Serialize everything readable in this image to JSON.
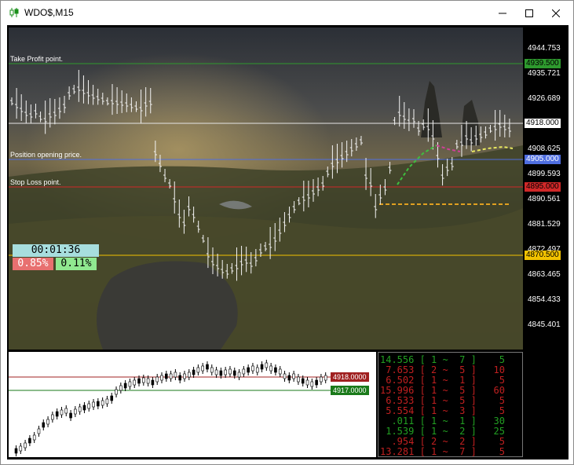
{
  "window": {
    "title": "WDO$,M15",
    "minimize_glyph": "—",
    "maximize_glyph": "☐",
    "close_glyph": "✕"
  },
  "main_chart": {
    "labels": {
      "take_profit": "Take Profit point.",
      "position_opening": "Position opening price.",
      "stop_loss": "Stop Loss point."
    },
    "timer": "00:01:36",
    "pct_left": "0.85%",
    "pct_right": "0.11%",
    "colors": {
      "take_profit": "#2e9a2e",
      "current": "#e6e6e6",
      "opening": "#4f6ee0",
      "stop_loss": "#d02828",
      "yellow": "#f2c200"
    }
  },
  "price_axis": {
    "ticks": [
      "4944.753",
      "4935.721",
      "4926.689",
      "4908.625",
      "4899.593",
      "4890.561",
      "4881.529",
      "4872.497",
      "4863.465",
      "4854.433",
      "4845.401"
    ],
    "badges": {
      "take_profit": "4939.500",
      "current": "4918.000",
      "opening": "4905.000",
      "stop_loss": "4895.000",
      "yellow": "4870.500"
    }
  },
  "sub_chart": {
    "badge_red": "4918.0000",
    "badge_green": "4917.0000"
  },
  "stats_table": {
    "rows": [
      {
        "val": "14.556",
        "a": "1",
        "b": "7",
        "n": "5",
        "color": "#22a022"
      },
      {
        "val": "7.653",
        "a": "2",
        "b": "5",
        "n": "10",
        "color": "#c02020"
      },
      {
        "val": "6.502",
        "a": "1",
        "b": "1",
        "n": "5",
        "color": "#c02020"
      },
      {
        "val": "15.996",
        "a": "1",
        "b": "5",
        "n": "60",
        "color": "#c02020"
      },
      {
        "val": "6.533",
        "a": "1",
        "b": "5",
        "n": "5",
        "color": "#c02020"
      },
      {
        "val": "5.554",
        "a": "1",
        "b": "3",
        "n": "5",
        "color": "#c02020"
      },
      {
        "val": ".011",
        "a": "1",
        "b": "1",
        "n": "30",
        "color": "#22a022"
      },
      {
        "val": "1.539",
        "a": "1",
        "b": "2",
        "n": "25",
        "color": "#22a022"
      },
      {
        "val": ".954",
        "a": "2",
        "b": "2",
        "n": "5",
        "color": "#c02020"
      },
      {
        "val": "13.281",
        "a": "1",
        "b": "7",
        "n": "5",
        "color": "#c02020"
      }
    ]
  }
}
